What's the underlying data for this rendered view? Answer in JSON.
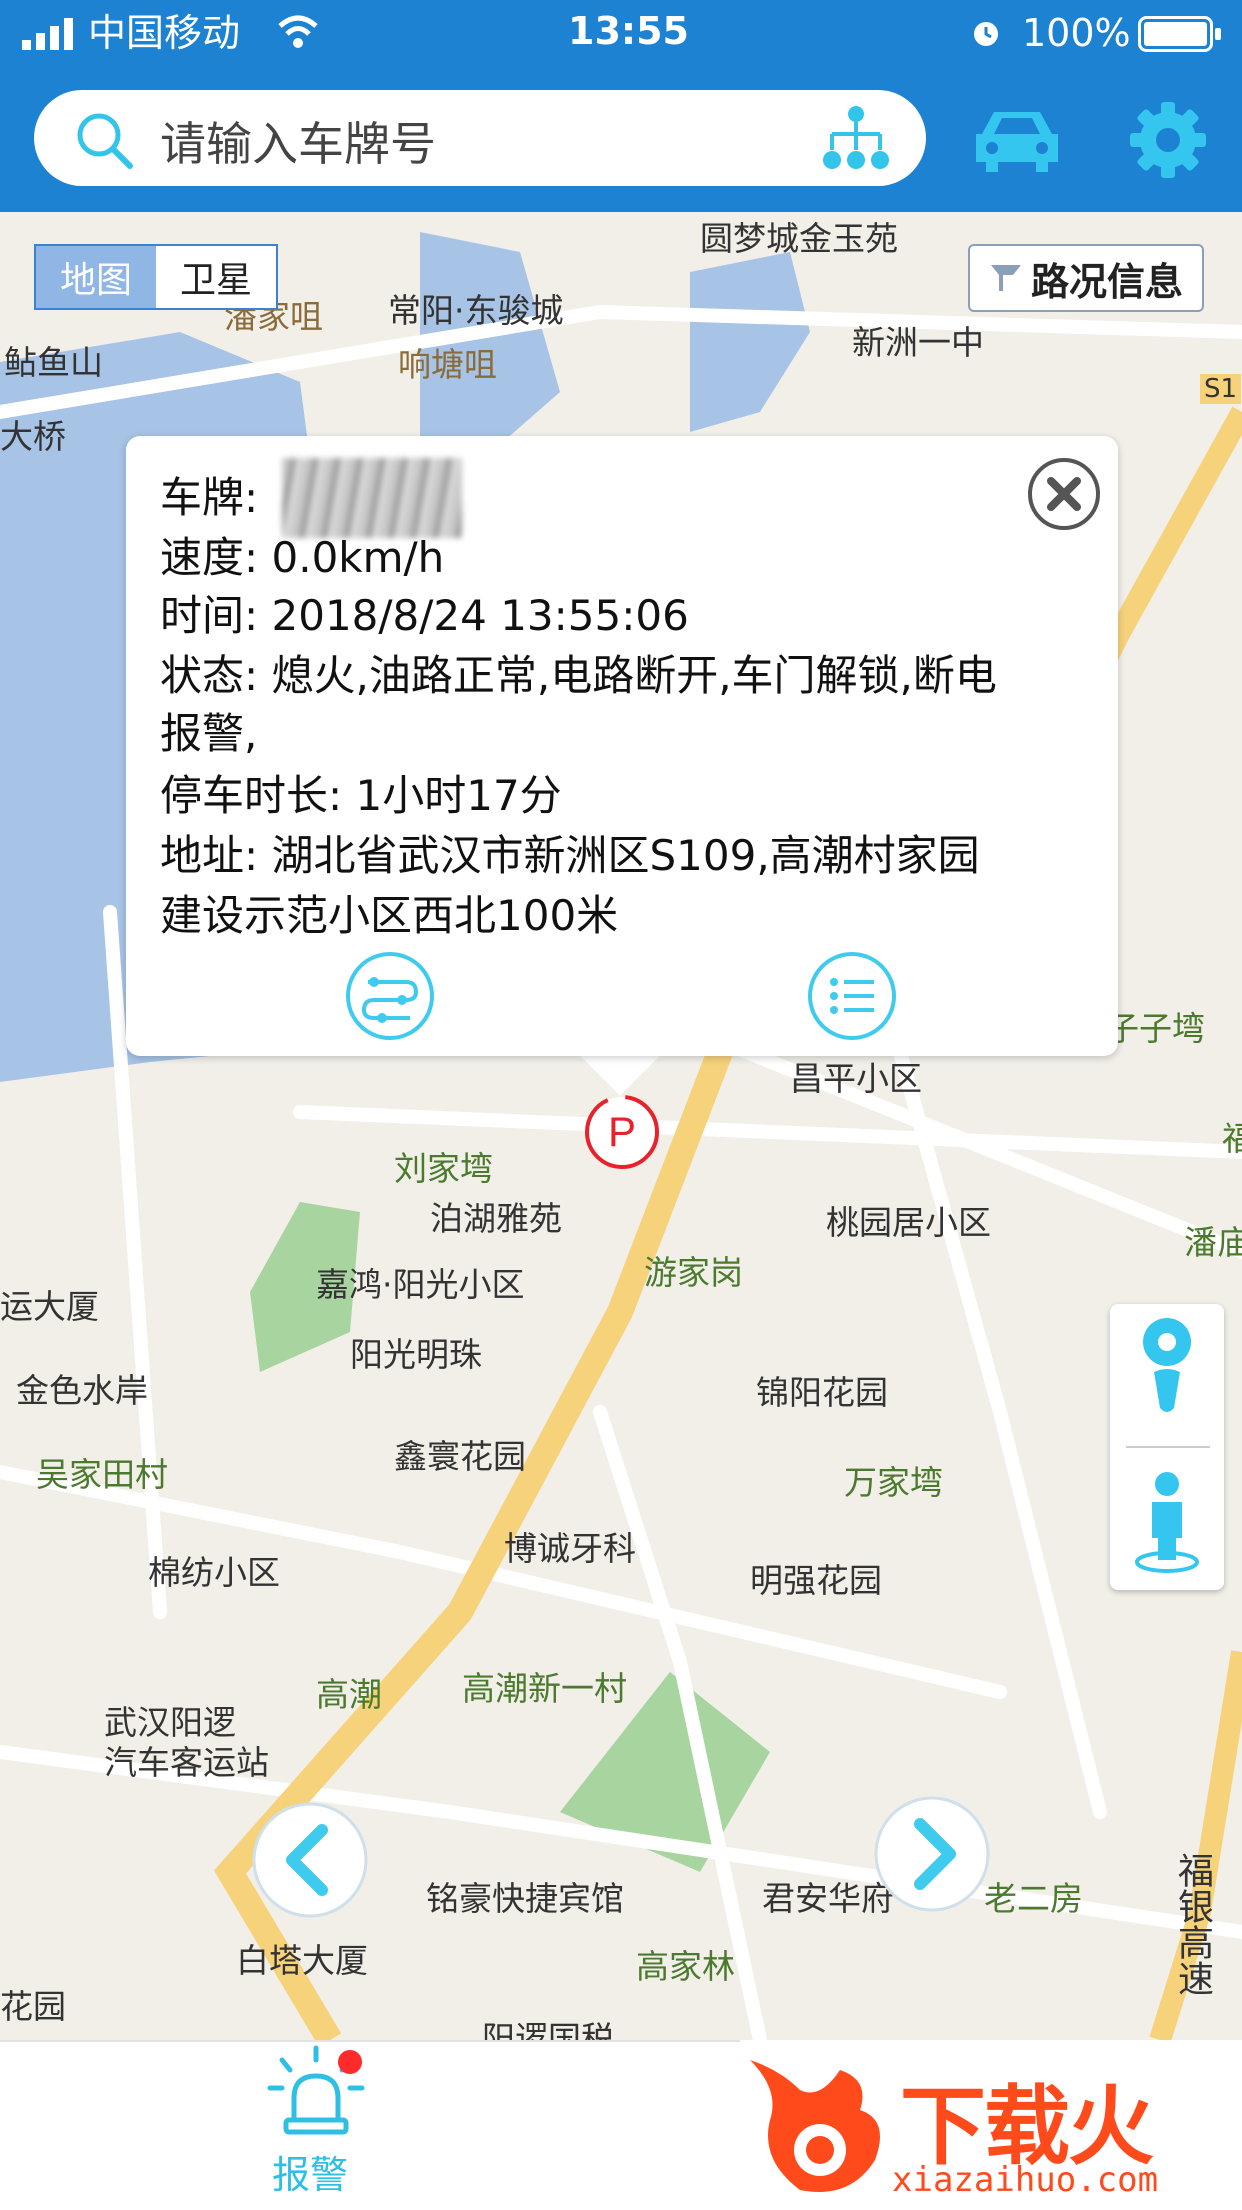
{
  "status_bar": {
    "carrier": "中国移动",
    "time": "13:55",
    "battery": "100%",
    "icons": [
      "signal-icon",
      "wifi-icon",
      "alarm-clock-icon",
      "battery-icon"
    ]
  },
  "header": {
    "search_placeholder": "请输入车牌号",
    "icons": [
      "search-icon",
      "org-tree-icon",
      "car-icon",
      "gear-icon"
    ],
    "accent_color": "#1d82d2"
  },
  "map_controls": {
    "map_type_tabs": [
      "地图",
      "卫星"
    ],
    "traffic_label": "路况信息"
  },
  "map_labels": {
    "l1": "圆梦城金玉苑",
    "l2": "潘家咀",
    "l3": "常阳·东骏城",
    "l4": "新洲一中",
    "l5": "鲇鱼山",
    "l6": "响塘咀",
    "l7": "大桥",
    "l8": "S1",
    "l9": "昌平小区",
    "l10": "子子塆",
    "l11": "刘家塆",
    "l12": "泊湖雅苑",
    "l13": "桃园居小区",
    "l14": "嘉鸿·阳光小区",
    "l15": "游家岗",
    "l16": "运大厦",
    "l17": "阳光明珠",
    "l18": "金色水岸",
    "l19": "锦阳花园",
    "l20": "吴家田村",
    "l21": "鑫寰花园",
    "l22": "万家塆",
    "l23": "博诚牙科",
    "l24": "棉纺小区",
    "l25": "明强花园",
    "l26": "高潮",
    "l27": "高潮新一村",
    "l28": "武汉阳逻",
    "l29": "汽车客运站",
    "l30": "铭豪快捷宾馆",
    "l31": "君安华府",
    "l32": "老二房",
    "l33": "白塔大厦",
    "l34": "高家林",
    "l35": "花园",
    "l36": "阳逻国税",
    "l37": "福银高速",
    "l38": "潘庙",
    "l39": "福"
  },
  "popup": {
    "plate_label": "车牌:",
    "speed": "速度: 0.0km/h",
    "time": "时间: 2018/8/24 13:55:06",
    "status_line1": "状态: 熄火,油路正常,电路断开,车门解锁,断电",
    "status_line2": "报警,",
    "parking_duration": "停车时长: 1小时17分",
    "address_line1": "地址: 湖北省武汉市新洲区S109,高潮村家园",
    "address_line2": "建设示范小区西北100米",
    "icons": [
      "close-icon",
      "track-route-icon",
      "list-detail-icon"
    ]
  },
  "marker": {
    "label": "P",
    "color": "#e8212b"
  },
  "bottom_nav": {
    "alarm_label": "报警",
    "alarm_color": "#2fbfe5"
  },
  "watermark": {
    "name": "下载火",
    "url": "xiazaihuo.com"
  }
}
